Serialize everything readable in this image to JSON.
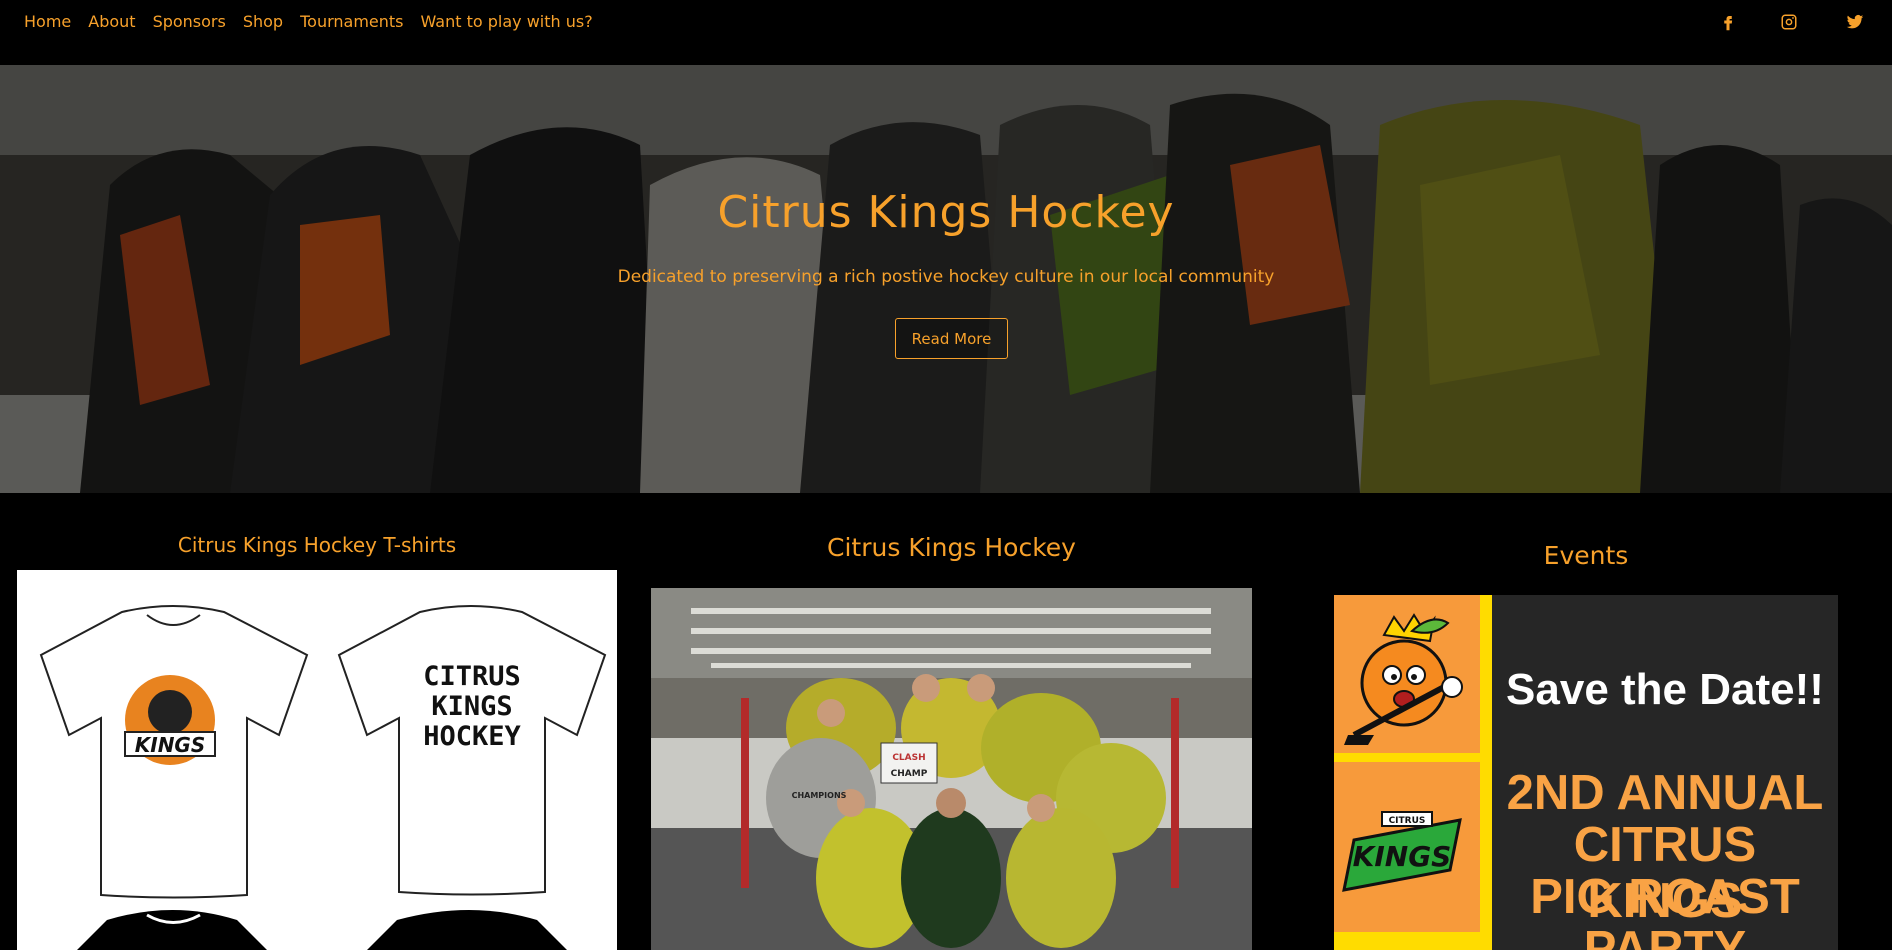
{
  "nav": {
    "links": [
      "Home",
      "About",
      "Sponsors",
      "Shop",
      "Tournaments",
      "Want to play with us?"
    ],
    "social": [
      "facebook-icon",
      "instagram-icon",
      "twitter-icon"
    ]
  },
  "hero": {
    "title": "Citrus Kings Hockey",
    "subtitle": "Dedicated to preserving a rich postive hockey culture in our local community",
    "button": "Read More"
  },
  "columns": {
    "shirts_title": "Citrus Kings Hockey T-shirts",
    "team_title": "Citrus Kings Hockey",
    "events_title": "Events"
  },
  "shirts": {
    "front_logo_text": "KINGS",
    "back_text": [
      "CITRUS",
      "KINGS",
      "HOCKEY"
    ]
  },
  "events_flyer": {
    "save_date": "Save the Date!!",
    "lines": [
      "2ND ANNUAL",
      "CITRUS KINGS",
      "PIG ROAST",
      "PARTY"
    ],
    "logo_small_text": "CITRUS",
    "logo_big_text": "KINGS"
  },
  "team_photo": {
    "sign_top": "CLASH",
    "sign_bottom": "CHAMP",
    "shirt_text": "CHAMPIONS"
  },
  "colors": {
    "accent": "#f7a12b",
    "background": "#000000"
  }
}
